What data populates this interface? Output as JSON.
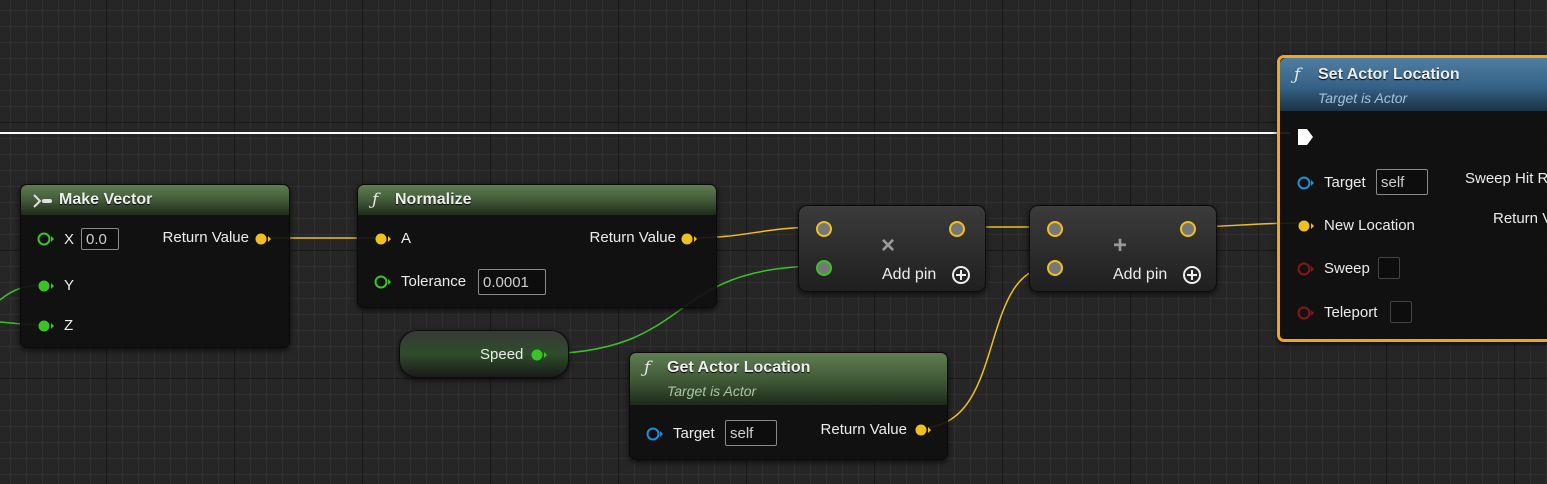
{
  "nodes": {
    "make_vector": {
      "title": "Make Vector",
      "x_label": "X",
      "x_value": "0.0",
      "y_label": "Y",
      "z_label": "Z",
      "return_label": "Return Value"
    },
    "normalize": {
      "title": "Normalize",
      "a_label": "A",
      "tolerance_label": "Tolerance",
      "tolerance_value": "0.0001",
      "return_label": "Return Value"
    },
    "speed": {
      "label": "Speed"
    },
    "get_actor_location": {
      "title": "Get Actor Location",
      "subtitle": "Target is Actor",
      "target_label": "Target",
      "target_value": "self",
      "return_label": "Return Value"
    },
    "multiply": {
      "op_symbol": "×",
      "add_pin_label": "Add pin"
    },
    "add": {
      "op_symbol": "+",
      "add_pin_label": "Add pin"
    },
    "set_actor_location": {
      "title": "Set Actor Location",
      "subtitle": "Target is Actor",
      "target_label": "Target",
      "target_value": "self",
      "new_location_label": "New Location",
      "sweep_label": "Sweep",
      "teleport_label": "Teleport",
      "sweep_hit_result_label": "Sweep Hit R",
      "return_label": "Return V"
    }
  },
  "colors": {
    "vector_pin": "#f0c020",
    "float_pin": "#39c424",
    "object_pin": "#1e8fd6",
    "bool_pin": "#8a1616",
    "exec_wire": "#ffffff",
    "selection": "#f2a41c"
  },
  "icons": {
    "function": "function-f-icon",
    "struct_make": "make-struct-icon",
    "add_pin": "circled-plus-icon"
  }
}
